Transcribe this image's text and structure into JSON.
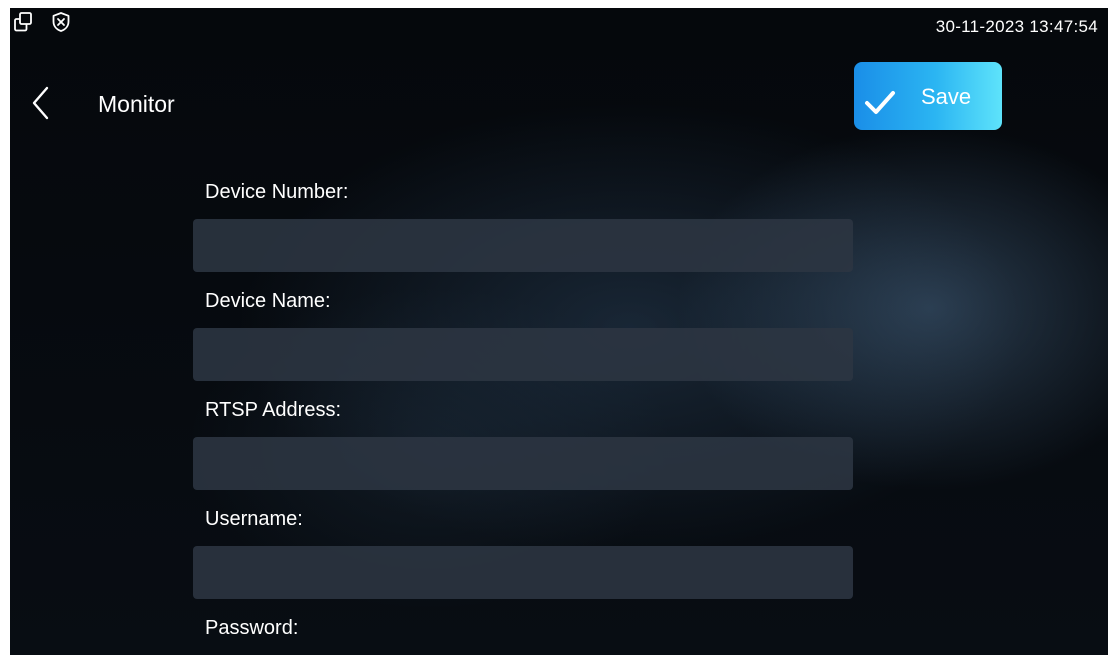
{
  "status_bar": {
    "icons": [
      "window-restore-icon",
      "shield-x-icon"
    ],
    "datetime": "30-11-2023 13:47:54"
  },
  "header": {
    "back_icon": "chevron-left-icon",
    "title": "Monitor",
    "save_icon": "checkmark-icon",
    "save_label": "Save"
  },
  "form": {
    "fields": [
      {
        "label": "Device Number:",
        "value": "",
        "placeholder": ""
      },
      {
        "label": "Device Name:",
        "value": "",
        "placeholder": ""
      },
      {
        "label": "RTSP Address:",
        "value": "",
        "placeholder": ""
      },
      {
        "label": "Username:",
        "value": "",
        "placeholder": ""
      },
      {
        "label": "Password:",
        "value": "",
        "placeholder": ""
      }
    ]
  },
  "colors": {
    "background": "#05080c",
    "input_background": "#2c3642",
    "save_gradient_start": "#1a8ee8",
    "save_gradient_end": "#5ee3fb",
    "text": "#ffffff"
  }
}
